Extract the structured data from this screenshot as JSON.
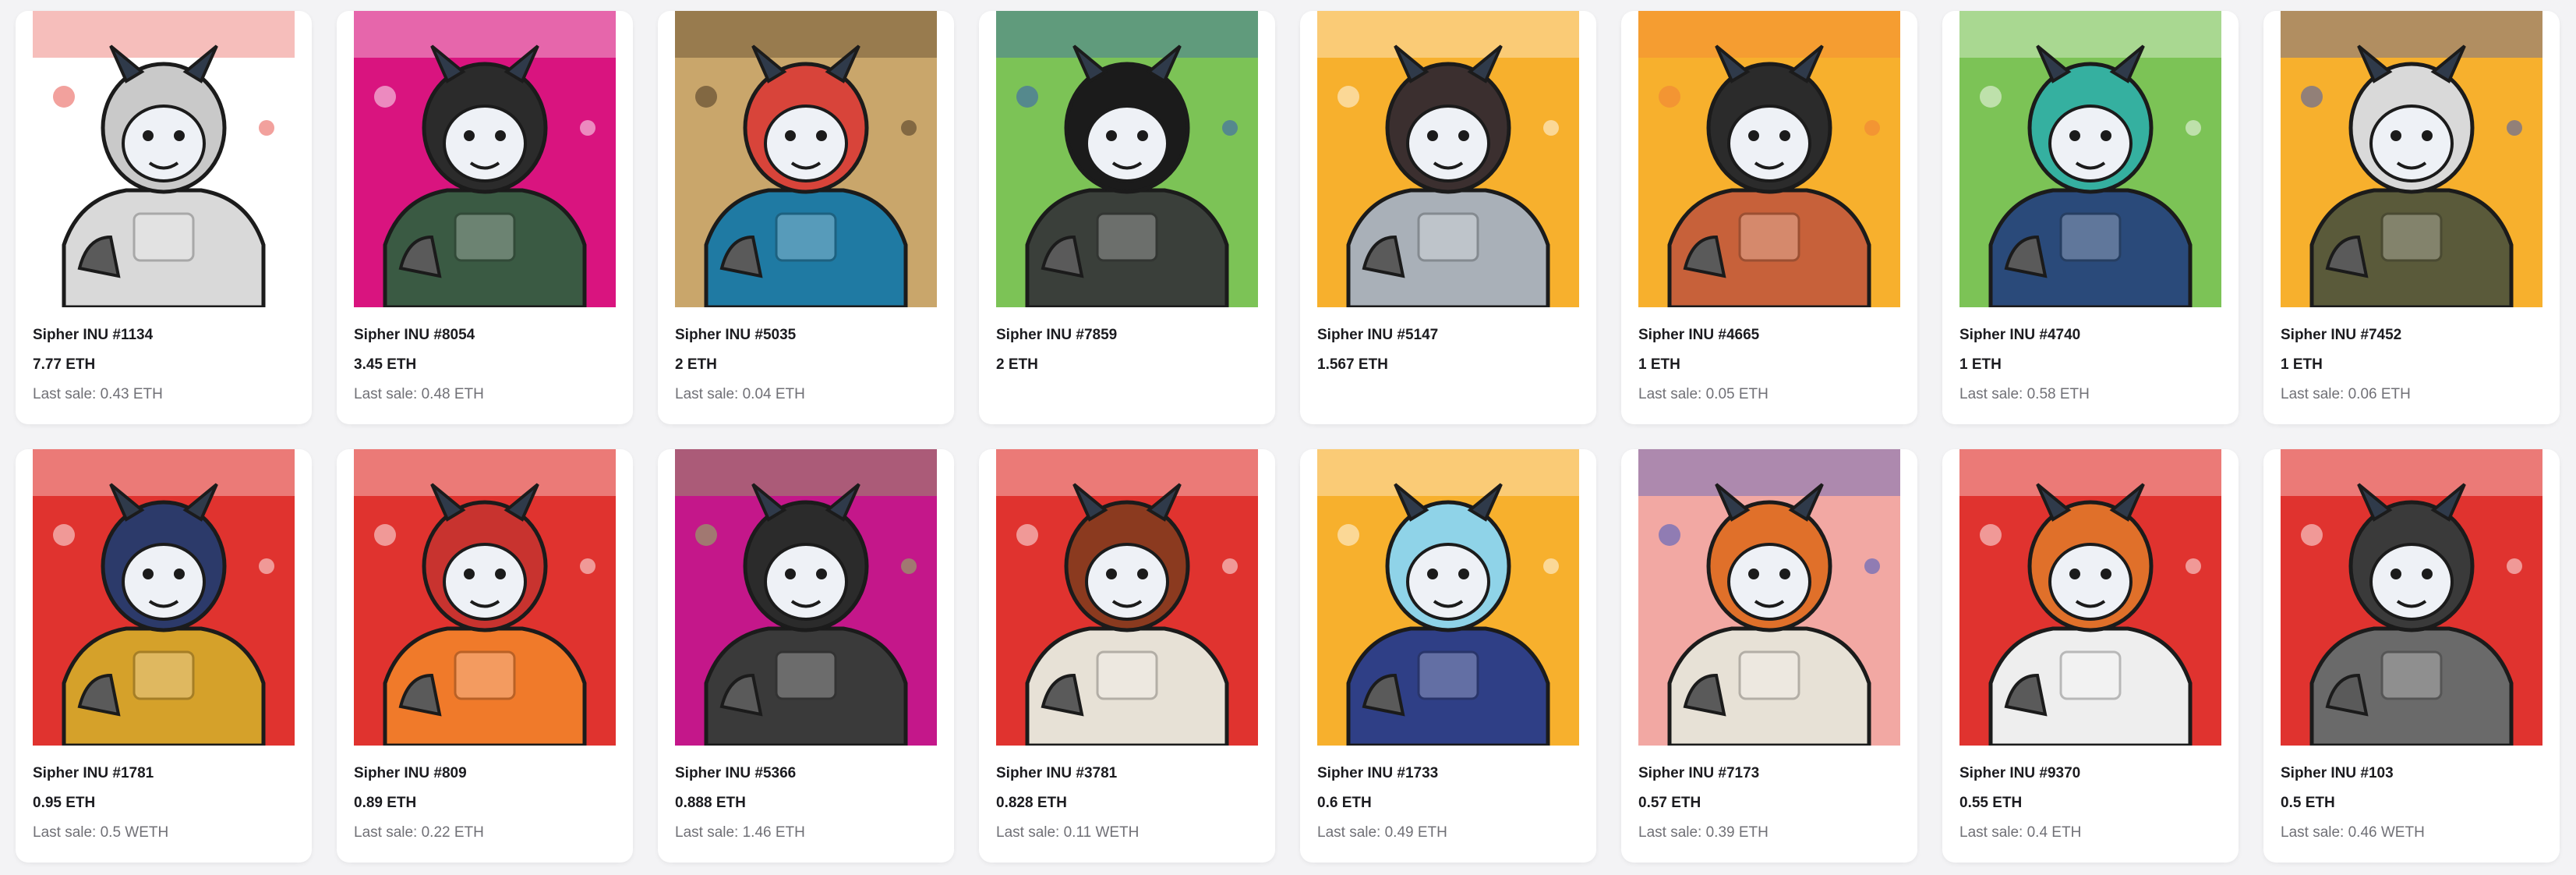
{
  "items": [
    {
      "name": "Sipher INU #1134",
      "price": "7.77 ETH",
      "last_sale": "Last sale: 0.43 ETH",
      "bg": "#ffffff",
      "accent": "#e5443c",
      "body": "#d9d9d9",
      "helmet": "#c9c9c9",
      "icon": "stripes-stars-art"
    },
    {
      "name": "Sipher INU #8054",
      "price": "3.45 ETH",
      "last_sale": "Last sale: 0.48 ETH",
      "bg": "#d9147f",
      "accent": "#ffffff",
      "body": "#3a5a43",
      "helmet": "#2b2b2b",
      "icon": "magenta-art"
    },
    {
      "name": "Sipher INU #5035",
      "price": "2 ETH",
      "last_sale": "Last sale: 0.04 ETH",
      "bg": "#c9a66b",
      "accent": "#3b2a1a",
      "body": "#1f7aa3",
      "helmet": "#d8443a",
      "icon": "wanted-poster-art"
    },
    {
      "name": "Sipher INU #7859",
      "price": "2 ETH",
      "last_sale": "",
      "bg": "#7cc356",
      "accent": "#2d4fc4",
      "body": "#3a3f3a",
      "helmet": "#1b1b1b",
      "icon": "green-art"
    },
    {
      "name": "Sipher INU #5147",
      "price": "1.567 ETH",
      "last_sale": "",
      "bg": "#f7b02d",
      "accent": "#ffffff",
      "body": "#a9b0b8",
      "helmet": "#3b2f2f",
      "icon": "orange-art"
    },
    {
      "name": "Sipher INU #4665",
      "price": "1 ETH",
      "last_sale": "Last sale: 0.05 ETH",
      "bg": "#f7b02d",
      "accent": "#f07a3a",
      "body": "#c7613a",
      "helmet": "#2b2b2b",
      "icon": "orange-fire-art"
    },
    {
      "name": "Sipher INU #4740",
      "price": "1 ETH",
      "last_sale": "Last sale: 0.58 ETH",
      "bg": "#7cc356",
      "accent": "#ffffff",
      "body": "#2a4a7a",
      "helmet": "#35b0a0",
      "icon": "green-art"
    },
    {
      "name": "Sipher INU #7452",
      "price": "1 ETH",
      "last_sale": "Last sale: 0.06 ETH",
      "bg": "#f7b02d",
      "accent": "#2d4fc4",
      "body": "#5a5a3a",
      "helmet": "#d9d9d9",
      "icon": "orange-art"
    },
    {
      "name": "Sipher INU #1781",
      "price": "0.95 ETH",
      "last_sale": "Last sale: 0.5 WETH",
      "bg": "#e0332f",
      "accent": "#ffffff",
      "body": "#d5a12a",
      "helmet": "#2c3a6a",
      "icon": "red-art"
    },
    {
      "name": "Sipher INU #809",
      "price": "0.89 ETH",
      "last_sale": "Last sale: 0.22 ETH",
      "bg": "#e0332f",
      "accent": "#ffffff",
      "body": "#f07a2a",
      "helmet": "#c8332f",
      "icon": "red-art"
    },
    {
      "name": "Sipher INU #5366",
      "price": "0.888 ETH",
      "last_sale": "Last sale: 1.46 ETH",
      "bg": "#c4178a",
      "accent": "#7ed957",
      "body": "#3a3a3a",
      "helmet": "#2b2b2b",
      "icon": "magenta-art"
    },
    {
      "name": "Sipher INU #3781",
      "price": "0.828 ETH",
      "last_sale": "Last sale: 0.11 WETH",
      "bg": "#e0332f",
      "accent": "#ffffff",
      "body": "#e7e1d6",
      "helmet": "#8b3a1f",
      "icon": "red-art"
    },
    {
      "name": "Sipher INU #1733",
      "price": "0.6 ETH",
      "last_sale": "Last sale: 0.49 ETH",
      "bg": "#f7b02d",
      "accent": "#ffffff",
      "body": "#2f3f86",
      "helmet": "#8fd3e8",
      "icon": "orange-art"
    },
    {
      "name": "Sipher INU #7173",
      "price": "0.57 ETH",
      "last_sale": "Last sale: 0.39 ETH",
      "bg": "#f2a8a3",
      "accent": "#2d4fc4",
      "body": "#e7e1d6",
      "helmet": "#e0702a",
      "icon": "pink-art"
    },
    {
      "name": "Sipher INU #9370",
      "price": "0.55 ETH",
      "last_sale": "Last sale: 0.4 ETH",
      "bg": "#e0332f",
      "accent": "#ffffff",
      "body": "#eeeeee",
      "helmet": "#e0702a",
      "icon": "red-art"
    },
    {
      "name": "Sipher INU #103",
      "price": "0.5 ETH",
      "last_sale": "Last sale: 0.46 WETH",
      "bg": "#e0332f",
      "accent": "#ffffff",
      "body": "#6a6a6a",
      "helmet": "#3a3a3a",
      "icon": "red-art"
    }
  ]
}
